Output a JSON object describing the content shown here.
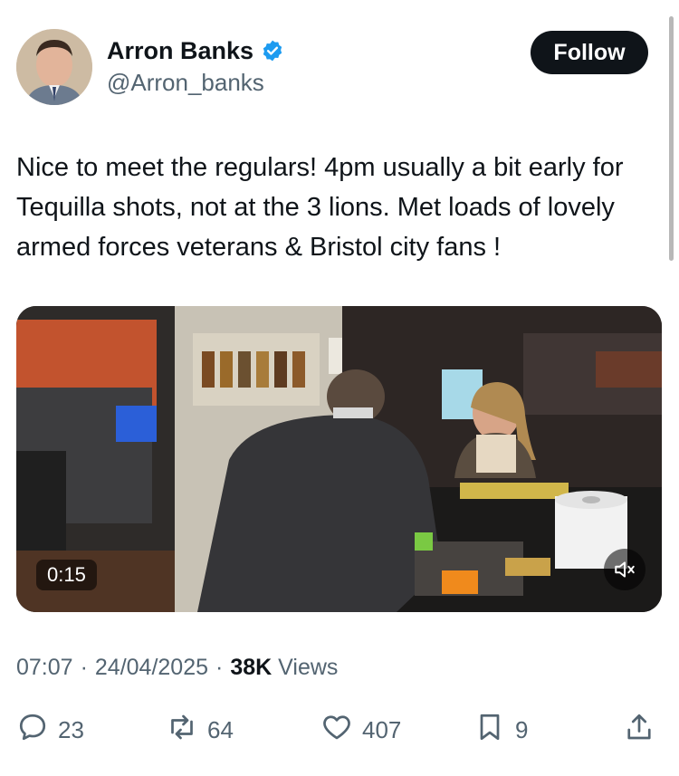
{
  "author": {
    "display_name": "Arron Banks",
    "handle": "@Arron_banks",
    "verified_color": "#1d9bf0"
  },
  "follow_label": "Follow",
  "tweet": {
    "text": "Nice to meet the regulars! 4pm usually a bit early for Tequilla shots, not at the 3 lions. Met loads of lovely armed forces veterans & Bristol city fans !"
  },
  "video": {
    "duration": "0:15",
    "mute_icon": "speaker-muted-icon"
  },
  "meta": {
    "time": "07:07",
    "date": "24/04/2025",
    "separator": "·",
    "views_count": "38K",
    "views_label": "Views"
  },
  "actions": {
    "replies": "23",
    "reposts": "64",
    "likes": "407",
    "bookmarks": "9"
  },
  "icons": {
    "reply": "reply-icon",
    "repost": "repost-icon",
    "like": "heart-icon",
    "bookmark": "bookmark-icon",
    "share": "share-icon"
  }
}
